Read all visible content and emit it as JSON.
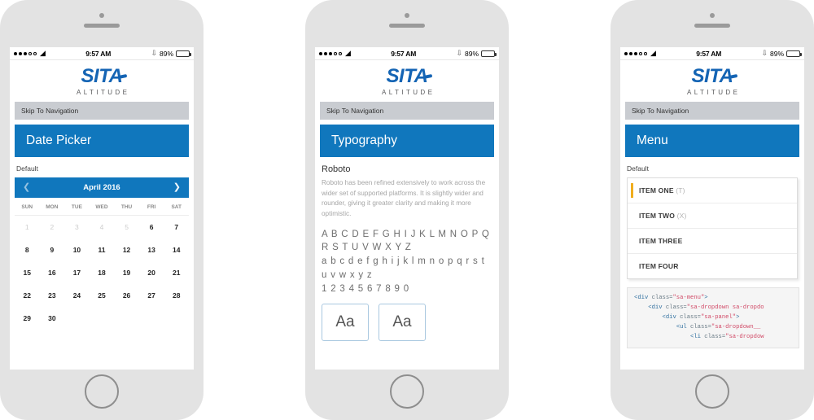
{
  "meta": {
    "page_background": "#ffffff",
    "phone_body_color": "#e3e3e3",
    "brand_blue": "#1077bd",
    "logo_blue": "#1464b4",
    "accent_yellow": "#f0ad1e"
  },
  "status_bar": {
    "signal_filled_dots": 3,
    "signal_hollow_dots": 2,
    "wifi_icon": "wifi-icon",
    "time": "9:57 AM",
    "bluetooth_icon": "bluetooth-icon",
    "battery_percent": "89%",
    "battery_icon": "battery-icon"
  },
  "brand": {
    "logo_primary": "SITA",
    "logo_secondary": "ALTITUDE"
  },
  "common": {
    "skip_nav": "Skip To Navigation",
    "default_label": "Default"
  },
  "phones": [
    {
      "id": "date-picker",
      "title": "Date Picker",
      "calendar": {
        "prev_icon": "chevron-left-icon",
        "next_icon": "chevron-right-icon",
        "month_label": "April 2016",
        "weekdays": [
          "SUN",
          "MON",
          "TUE",
          "WED",
          "THU",
          "FRI",
          "SAT"
        ],
        "weeks": [
          [
            {
              "day": "1",
              "muted": true
            },
            {
              "day": "2",
              "muted": true
            },
            {
              "day": "3",
              "muted": true
            },
            {
              "day": "4",
              "muted": true
            },
            {
              "day": "5",
              "muted": true
            },
            {
              "day": "6",
              "muted": false
            },
            {
              "day": "7",
              "muted": false
            }
          ],
          [
            {
              "day": "8",
              "muted": false
            },
            {
              "day": "9",
              "muted": false
            },
            {
              "day": "10",
              "muted": false
            },
            {
              "day": "11",
              "muted": false
            },
            {
              "day": "12",
              "muted": false
            },
            {
              "day": "13",
              "muted": false
            },
            {
              "day": "14",
              "muted": false
            }
          ],
          [
            {
              "day": "15",
              "muted": false
            },
            {
              "day": "16",
              "muted": false
            },
            {
              "day": "17",
              "muted": false
            },
            {
              "day": "18",
              "muted": false
            },
            {
              "day": "19",
              "muted": false
            },
            {
              "day": "20",
              "muted": false
            },
            {
              "day": "21",
              "muted": false
            }
          ],
          [
            {
              "day": "22",
              "muted": false
            },
            {
              "day": "23",
              "muted": false
            },
            {
              "day": "24",
              "muted": false
            },
            {
              "day": "25",
              "muted": false
            },
            {
              "day": "26",
              "muted": false
            },
            {
              "day": "27",
              "muted": false
            },
            {
              "day": "28",
              "muted": false
            }
          ],
          [
            {
              "day": "29",
              "muted": false
            },
            {
              "day": "30",
              "muted": false
            },
            {
              "day": "",
              "muted": false
            },
            {
              "day": "",
              "muted": false
            },
            {
              "day": "",
              "muted": false
            },
            {
              "day": "",
              "muted": false
            },
            {
              "day": "",
              "muted": false
            }
          ]
        ]
      }
    },
    {
      "id": "typography",
      "title": "Typography",
      "typography": {
        "font_name": "Roboto",
        "description": "Roboto has been refined extensively to work across the wider set of supported platforms. It is slightly wider and rounder, giving it greater clarity and making it more optimistic.",
        "specimen_lines": [
          "A B C D E F G H I J K L M N O P Q",
          "R S T U V W X Y Z",
          "a b c d e f g h i j k l m n o p q r s t",
          "u v w x y z",
          "1 2 3 4 5 6 7 8 9 0"
        ],
        "sample_boxes": [
          "Aa",
          "Aa"
        ]
      }
    },
    {
      "id": "menu",
      "title": "Menu",
      "menu": {
        "items": [
          {
            "label": "ITEM ONE",
            "hint": "(T)",
            "active": true
          },
          {
            "label": "ITEM TWO",
            "hint": "(X)",
            "active": false
          },
          {
            "label": "ITEM THREE",
            "hint": "",
            "active": false
          },
          {
            "label": "ITEM FOUR",
            "hint": "",
            "active": false
          }
        ],
        "code_lines": [
          [
            {
              "t": "tag",
              "v": "<div "
            },
            {
              "t": "attr",
              "v": "class="
            },
            {
              "t": "str",
              "v": "\"sa-menu\""
            },
            {
              "t": "tag",
              "v": ">"
            }
          ],
          [
            {
              "t": "tag",
              "v": "    <div "
            },
            {
              "t": "attr",
              "v": "class="
            },
            {
              "t": "str",
              "v": "\"sa-dropdown sa-dropdo"
            }
          ],
          [
            {
              "t": "tag",
              "v": "        <div "
            },
            {
              "t": "attr",
              "v": "class="
            },
            {
              "t": "str",
              "v": "\"sa-panel\""
            },
            {
              "t": "tag",
              "v": ">"
            }
          ],
          [
            {
              "t": "tag",
              "v": "            <ul "
            },
            {
              "t": "attr",
              "v": "class="
            },
            {
              "t": "str",
              "v": "\"sa-dropdown__"
            }
          ],
          [
            {
              "t": "tag",
              "v": "                <li "
            },
            {
              "t": "attr",
              "v": "class="
            },
            {
              "t": "str",
              "v": "\"sa-dropdow"
            }
          ]
        ]
      }
    }
  ]
}
